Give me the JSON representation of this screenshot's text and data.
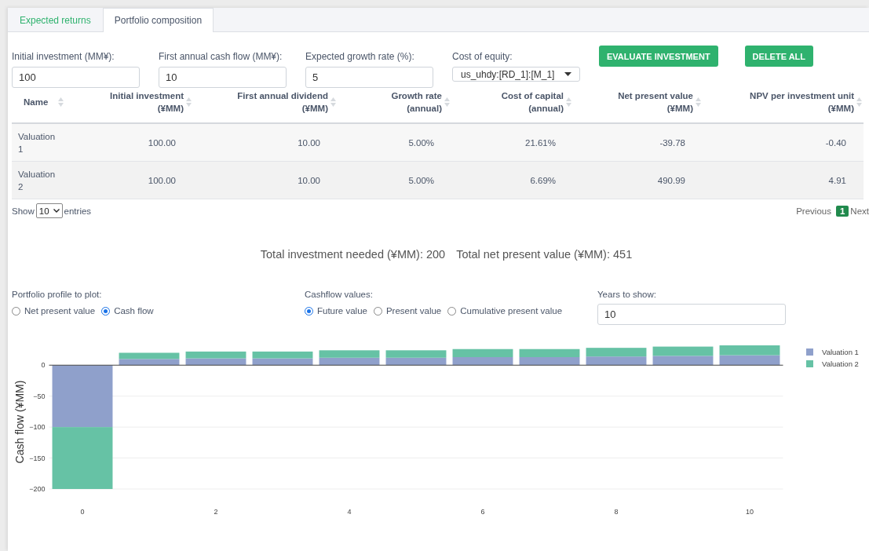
{
  "tabs": [
    {
      "label": "Expected returns",
      "selected": false
    },
    {
      "label": "Portfolio composition",
      "selected": true
    }
  ],
  "form": {
    "fields": [
      {
        "label": "Initial investment (MM¥):",
        "value": "100"
      },
      {
        "label": "First annual cash flow (MM¥):",
        "value": "10"
      },
      {
        "label": "Expected growth rate (%):",
        "value": "5"
      }
    ],
    "select": {
      "label": "Cost of equity:",
      "value": "us_uhdy:[RD_1]:[M_1]"
    },
    "buttons": [
      "EVALUATE INVESTMENT",
      "DELETE ALL"
    ]
  },
  "table": {
    "columns": [
      {
        "line1": "Name"
      },
      {
        "line1": "Initial investment",
        "line2": "(¥MM)"
      },
      {
        "line1": "First annual dividend",
        "line2": "(¥MM)"
      },
      {
        "line1": "Growth rate",
        "line2": "(annual)"
      },
      {
        "line1": "Cost of capital",
        "line2": "(annual)"
      },
      {
        "line1": "Net present value",
        "line2": "(¥MM)"
      },
      {
        "line1": "NPV per investment unit",
        "line2": "(¥MM)"
      }
    ],
    "rows": [
      [
        "Valuation 1",
        "100.00",
        "10.00",
        "5.00%",
        "21.61%",
        "-39.78",
        "-0.40"
      ],
      [
        "Valuation 2",
        "100.00",
        "10.00",
        "5.00%",
        "6.69%",
        "490.99",
        "4.91"
      ]
    ],
    "footer": {
      "show": "Show",
      "length": "10",
      "entries": "entries",
      "previous": "Previous",
      "pages": [
        {
          "label": "1",
          "selected": true
        }
      ],
      "next": "Next"
    }
  },
  "totals": [
    "Total investment needed (¥MM): 200",
    "Total net present value (¥MM): 451"
  ],
  "controls": {
    "profile": {
      "label": "Portfolio profile to plot:",
      "options": [
        {
          "label": "Net present value",
          "selected": false
        },
        {
          "label": "Cash flow",
          "selected": true
        }
      ]
    },
    "cashflow": {
      "label": "Cashflow values:",
      "options": [
        {
          "label": "Future value",
          "selected": true
        },
        {
          "label": "Present value",
          "selected": false
        },
        {
          "label": "Cumulative present value",
          "selected": false
        }
      ]
    },
    "years": {
      "label": "Years to show:",
      "value": "10"
    }
  },
  "chart_data": {
    "type": "bar",
    "stacked": true,
    "ylabel": "Cash flow (¥MM)",
    "x": [
      0,
      1,
      2,
      3,
      4,
      5,
      6,
      7,
      8,
      9,
      10
    ],
    "xlim": [
      -0.5,
      10.5
    ],
    "xticks": [
      0,
      2,
      4,
      6,
      8,
      10
    ],
    "yticks": [
      -200,
      -150,
      -100,
      -50,
      0
    ],
    "ylim": [
      -200,
      32
    ],
    "grid": true,
    "legend": true,
    "series": [
      {
        "name": "Valuation 1",
        "color": "#8fa0cb",
        "values": [
          -100,
          10,
          11,
          11,
          12,
          12,
          13,
          13,
          14,
          15,
          16
        ]
      },
      {
        "name": "Valuation 2",
        "color": "#66c2a5",
        "values": [
          -100,
          10,
          11,
          11,
          12,
          12,
          13,
          13,
          14,
          15,
          16
        ]
      }
    ]
  }
}
